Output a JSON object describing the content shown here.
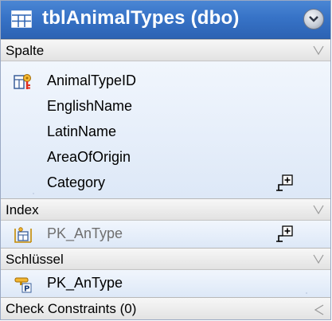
{
  "title": "tblAnimalTypes (dbo)",
  "icons": {
    "table": "table-grid-icon",
    "collapse": "collapse-circle-icon",
    "primary_key_column": "primary-key-column-icon",
    "index": "index-icon",
    "primary_key": "primary-key-icon",
    "add": "add-relation-icon"
  },
  "sections": {
    "columns": {
      "label": "Spalte"
    },
    "index": {
      "label": "Index"
    },
    "keys": {
      "label": "Schlüssel"
    },
    "checks": {
      "label": "Check Constraints (0)"
    }
  },
  "columns": [
    {
      "name": "AnimalTypeID",
      "is_primary_key": true
    },
    {
      "name": "EnglishName"
    },
    {
      "name": "LatinName"
    },
    {
      "name": "AreaOfOrigin"
    },
    {
      "name": "Category"
    }
  ],
  "indexes": [
    {
      "name": "PK_AnType"
    }
  ],
  "keys": [
    {
      "name": "PK_AnType"
    }
  ],
  "colors": {
    "title_bar": "#3773c7",
    "body_bg": "#e9f0fa",
    "header_bg": "#e9e9e9"
  }
}
